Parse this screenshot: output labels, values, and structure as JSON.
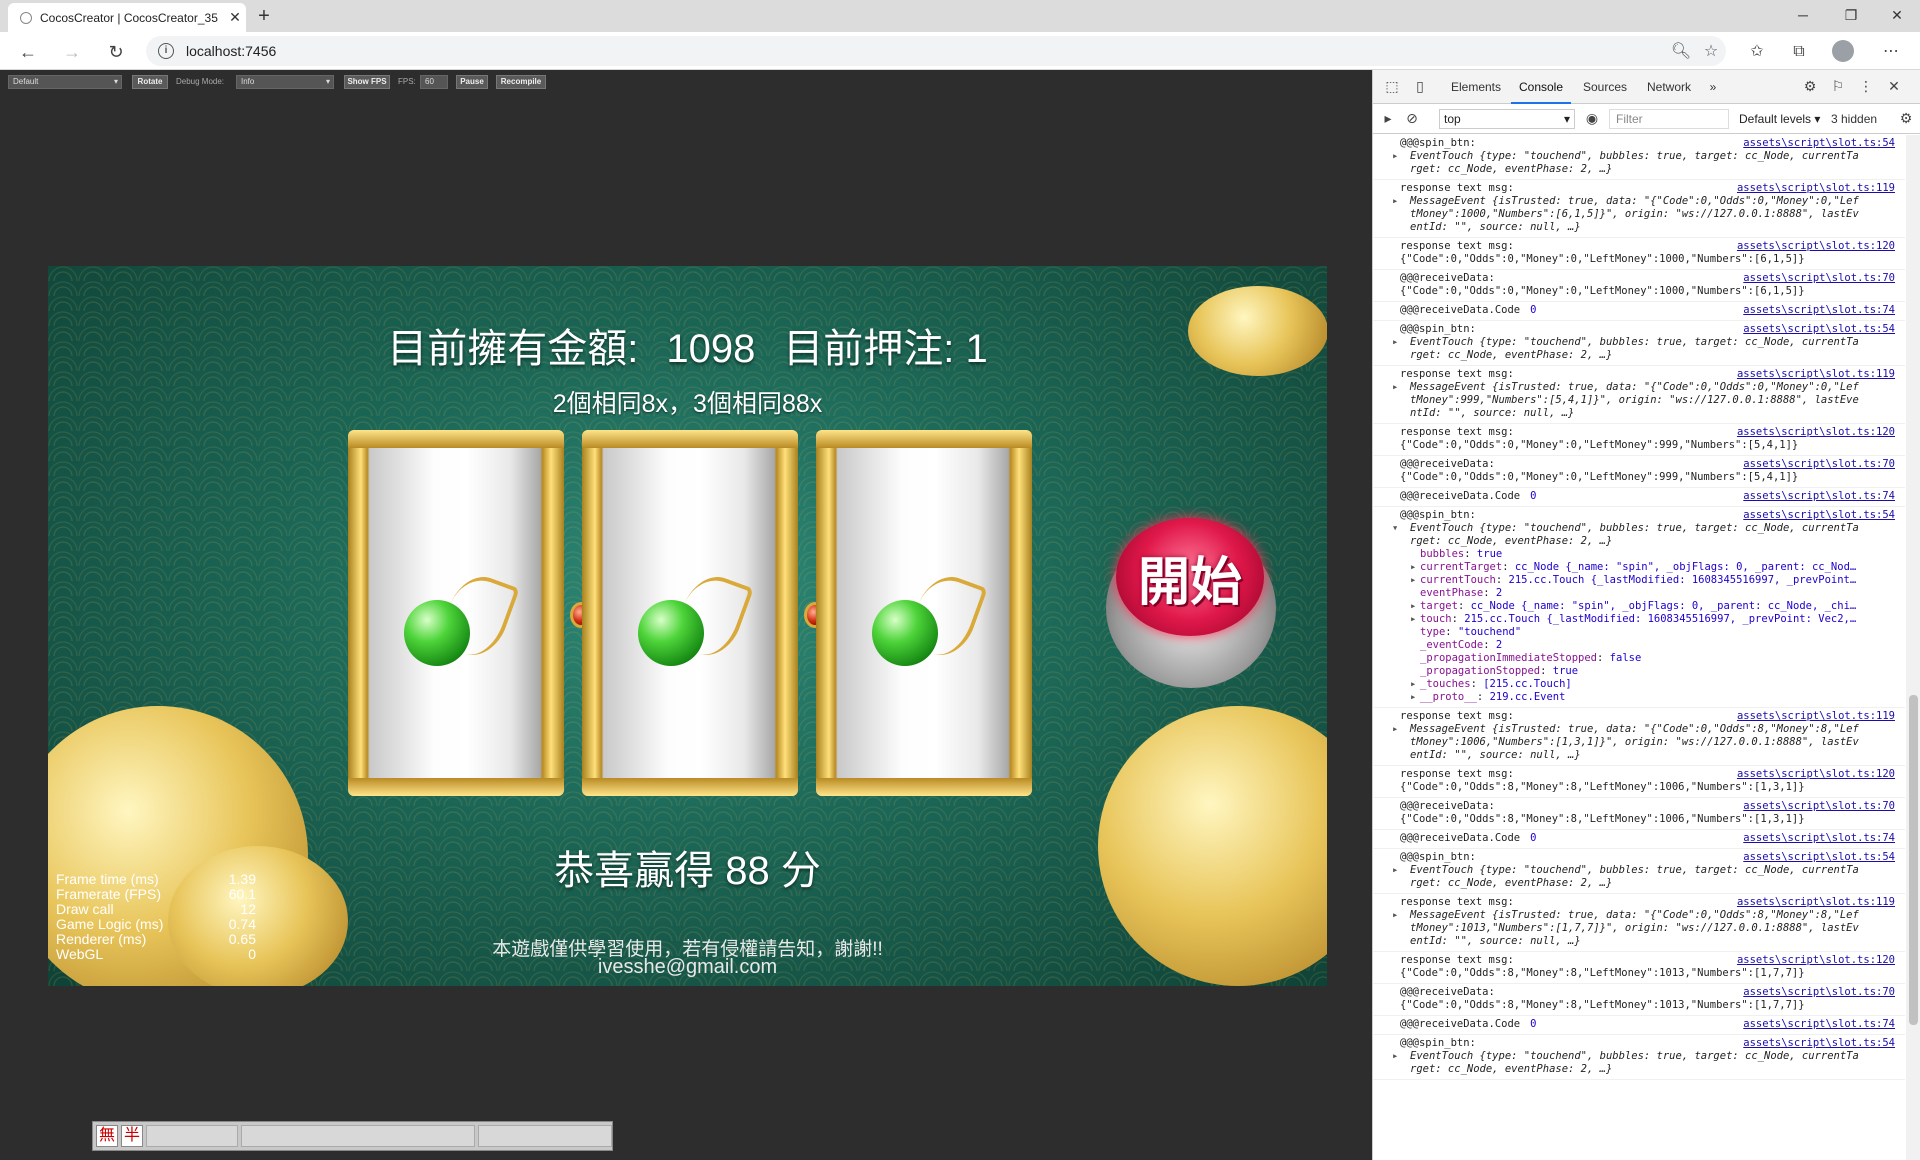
{
  "browser": {
    "tab_title": "CocosCreator | CocosCreator_35",
    "tab_close": "✕",
    "new_tab": "+",
    "url": "localhost:7456",
    "win_min": "─",
    "win_max": "❐",
    "win_close": "✕"
  },
  "cc": {
    "device": "Default",
    "rotate": "Rotate",
    "debug_label": "Debug Mode:",
    "debug_value": "Info",
    "show_fps": "Show FPS",
    "fps_label": "FPS:",
    "fps_value": "60",
    "pause": "Pause",
    "recompile": "Recompile"
  },
  "game": {
    "money_label": "目前擁有金額:",
    "money": "1098",
    "bet_label": "目前押注: 1",
    "payout": "2個相同8x，3個相同88x",
    "spin": "開始",
    "win": "恭喜贏得 88 分",
    "notice": "本遊戲僅供學習使用，若有侵權請告知，謝謝!!",
    "email": "ivesshe@gmail.com",
    "stats": [
      {
        "k": "Frame time (ms)",
        "v": "1.39"
      },
      {
        "k": "Framerate (FPS)",
        "v": "60.1"
      },
      {
        "k": "Draw call",
        "v": "12"
      },
      {
        "k": "Game Logic (ms)",
        "v": "0.74"
      },
      {
        "k": "Renderer (ms)",
        "v": "0.65"
      },
      {
        "k": "WebGL",
        "v": "0"
      }
    ]
  },
  "ime": {
    "k1": "無",
    "k2": "半"
  },
  "devtools": {
    "tabs": [
      "Elements",
      "Console",
      "Sources",
      "Network"
    ],
    "more": "»",
    "context": "top",
    "filter": "Filter",
    "levels": "Default levels ▾",
    "hidden": "3 hidden",
    "entries": [
      {
        "t": "@@@spin_btn:",
        "src": "assets\\script\\slot.ts:54",
        "o1": "EventTouch {type: \"touchend\", bubbles: true, target: cc_Node, currentTa",
        "o2": "rget: cc_Node, eventPhase: 2, …}"
      },
      {
        "t": "response text msg:",
        "src": "assets\\script\\slot.ts:119",
        "o1": "MessageEvent {isTrusted: true, data: \"{\"Code\":0,\"Odds\":0,\"Money\":0,\"Lef",
        "o2": "tMoney\":1000,\"Numbers\":[6,1,5]}\", origin: \"ws://127.0.0.1:8888\", lastEv",
        "o3": "entId: \"\", source: null, …}"
      },
      {
        "t": "response text msg:",
        "src": "assets\\script\\slot.ts:120",
        "d": "{\"Code\":0,\"Odds\":0,\"Money\":0,\"LeftMoney\":1000,\"Numbers\":[6,1,5]}"
      },
      {
        "t": "@@@receiveData:",
        "src": "assets\\script\\slot.ts:70",
        "d": "{\"Code\":0,\"Odds\":0,\"Money\":0,\"LeftMoney\":1000,\"Numbers\":[6,1,5]}"
      },
      {
        "t": "@@@receiveData.Code",
        "src": "assets\\script\\slot.ts:74",
        "n": "0"
      },
      {
        "t": "@@@spin_btn:",
        "src": "assets\\script\\slot.ts:54",
        "o1": "EventTouch {type: \"touchend\", bubbles: true, target: cc_Node, currentTa",
        "o2": "rget: cc_Node, eventPhase: 2, …}"
      },
      {
        "t": "response text msg:",
        "src": "assets\\script\\slot.ts:119",
        "o1": "MessageEvent {isTrusted: true, data: \"{\"Code\":0,\"Odds\":0,\"Money\":0,\"Lef",
        "o2": "tMoney\":999,\"Numbers\":[5,4,1]}\", origin: \"ws://127.0.0.1:8888\", lastEve",
        "o3": "ntId: \"\", source: null, …}"
      },
      {
        "t": "response text msg:",
        "src": "assets\\script\\slot.ts:120",
        "d": "{\"Code\":0,\"Odds\":0,\"Money\":0,\"LeftMoney\":999,\"Numbers\":[5,4,1]}"
      },
      {
        "t": "@@@receiveData:",
        "src": "assets\\script\\slot.ts:70",
        "d": "{\"Code\":0,\"Odds\":0,\"Money\":0,\"LeftMoney\":999,\"Numbers\":[5,4,1]}"
      },
      {
        "t": "@@@receiveData.Code",
        "src": "assets\\script\\slot.ts:74",
        "n": "0"
      },
      {
        "t": "@@@spin_btn:",
        "src": "assets\\script\\slot.ts:54",
        "open": true,
        "o1": "EventTouch {type: \"touchend\", bubbles: true, target: cc_Node, currentTa",
        "o2": "rget: cc_Node, eventPhase: 2, …}",
        "props": [
          {
            "k": "bubbles",
            "v": "true"
          },
          {
            "k": "currentTarget",
            "v": "cc_Node {_name: \"spin\", _objFlags: 0, _parent: cc_Nod…",
            "tog": true
          },
          {
            "k": "currentTouch",
            "v": "215.cc.Touch {_lastModified: 1608345516997, _prevPoint…",
            "tog": true
          },
          {
            "k": "eventPhase",
            "v": "2"
          },
          {
            "k": "target",
            "v": "cc_Node {_name: \"spin\", _objFlags: 0, _parent: cc_Node, _chi…",
            "tog": true
          },
          {
            "k": "touch",
            "v": "215.cc.Touch {_lastModified: 1608345516997, _prevPoint: Vec2,…",
            "tog": true
          },
          {
            "k": "type",
            "v": "\"touchend\""
          },
          {
            "k": "_eventCode",
            "v": "2"
          },
          {
            "k": "_propagationImmediateStopped",
            "v": "false"
          },
          {
            "k": "_propagationStopped",
            "v": "true"
          },
          {
            "k": "_touches",
            "v": "[215.cc.Touch]",
            "tog": true
          },
          {
            "k": "__proto__",
            "v": "219.cc.Event",
            "tog": true
          }
        ]
      },
      {
        "t": "response text msg:",
        "src": "assets\\script\\slot.ts:119",
        "o1": "MessageEvent {isTrusted: true, data: \"{\"Code\":0,\"Odds\":8,\"Money\":8,\"Lef",
        "o2": "tMoney\":1006,\"Numbers\":[1,3,1]}\", origin: \"ws://127.0.0.1:8888\", lastEv",
        "o3": "entId: \"\", source: null, …}"
      },
      {
        "t": "response text msg:",
        "src": "assets\\script\\slot.ts:120",
        "d": "{\"Code\":0,\"Odds\":8,\"Money\":8,\"LeftMoney\":1006,\"Numbers\":[1,3,1]}"
      },
      {
        "t": "@@@receiveData:",
        "src": "assets\\script\\slot.ts:70",
        "d": "{\"Code\":0,\"Odds\":8,\"Money\":8,\"LeftMoney\":1006,\"Numbers\":[1,3,1]}"
      },
      {
        "t": "@@@receiveData.Code",
        "src": "assets\\script\\slot.ts:74",
        "n": "0"
      },
      {
        "t": "@@@spin_btn:",
        "src": "assets\\script\\slot.ts:54",
        "o1": "EventTouch {type: \"touchend\", bubbles: true, target: cc_Node, currentTa",
        "o2": "rget: cc_Node, eventPhase: 2, …}"
      },
      {
        "t": "response text msg:",
        "src": "assets\\script\\slot.ts:119",
        "o1": "MessageEvent {isTrusted: true, data: \"{\"Code\":0,\"Odds\":8,\"Money\":8,\"Lef",
        "o2": "tMoney\":1013,\"Numbers\":[1,7,7]}\", origin: \"ws://127.0.0.1:8888\", lastEv",
        "o3": "entId: \"\", source: null, …}"
      },
      {
        "t": "response text msg:",
        "src": "assets\\script\\slot.ts:120",
        "d": "{\"Code\":0,\"Odds\":8,\"Money\":8,\"LeftMoney\":1013,\"Numbers\":[1,7,7]}"
      },
      {
        "t": "@@@receiveData:",
        "src": "assets\\script\\slot.ts:70",
        "d": "{\"Code\":0,\"Odds\":8,\"Money\":8,\"LeftMoney\":1013,\"Numbers\":[1,7,7]}"
      },
      {
        "t": "@@@receiveData.Code",
        "src": "assets\\script\\slot.ts:74",
        "n": "0"
      },
      {
        "t": "@@@spin_btn:",
        "src": "assets\\script\\slot.ts:54",
        "o1": "EventTouch {type: \"touchend\", bubbles: true, target: cc_Node, currentTa",
        "o2": "rget: cc_Node, eventPhase: 2, …}"
      }
    ]
  }
}
